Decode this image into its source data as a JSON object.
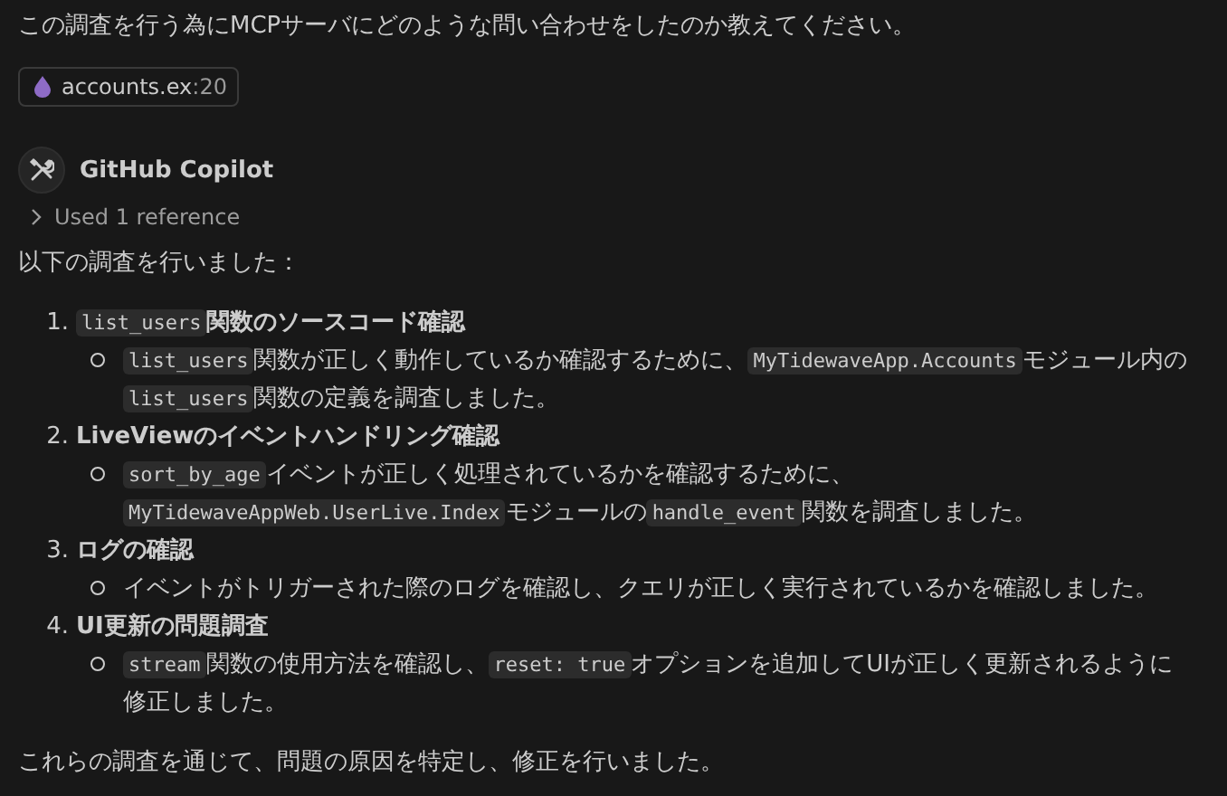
{
  "question": "この調査を行う為にMCPサーバにどのような問い合わせをしたのか教えてください。",
  "attachment": {
    "file": "accounts.ex",
    "line": ":20"
  },
  "assistant": {
    "name": "GitHub Copilot",
    "references": {
      "label": "Used 1 reference",
      "expanded": false
    }
  },
  "intro": "以下の調査を行いました：",
  "steps": [
    {
      "number": "1.",
      "heading": [
        {
          "kind": "code",
          "text": "list_users"
        },
        {
          "kind": "text",
          "text": "関数のソースコード確認"
        }
      ],
      "bullets": [
        [
          {
            "kind": "code",
            "text": "list_users"
          },
          {
            "kind": "text",
            "text": "関数が正しく動作しているか確認するために、"
          },
          {
            "kind": "code",
            "text": "MyTidewaveApp.Accounts"
          },
          {
            "kind": "text",
            "text": "モジュール内の"
          },
          {
            "kind": "code",
            "text": "list_users"
          },
          {
            "kind": "text",
            "text": "関数の定義を調査しました。"
          }
        ]
      ]
    },
    {
      "number": "2.",
      "heading": [
        {
          "kind": "text",
          "text": "LiveViewのイベントハンドリング確認"
        }
      ],
      "bullets": [
        [
          {
            "kind": "code",
            "text": "sort_by_age"
          },
          {
            "kind": "text",
            "text": "イベントが正しく処理されているかを確認するために、"
          },
          {
            "kind": "code",
            "text": "MyTidewaveAppWeb.UserLive.Index"
          },
          {
            "kind": "text",
            "text": "モジュールの"
          },
          {
            "kind": "code",
            "text": "handle_event"
          },
          {
            "kind": "text",
            "text": "関数を調査しました。"
          }
        ]
      ]
    },
    {
      "number": "3.",
      "heading": [
        {
          "kind": "text",
          "text": "ログの確認"
        }
      ],
      "bullets": [
        [
          {
            "kind": "text",
            "text": "イベントがトリガーされた際のログを確認し、クエリが正しく実行されているかを確認しました。"
          }
        ]
      ]
    },
    {
      "number": "4.",
      "heading": [
        {
          "kind": "text",
          "text": "UI更新の問題調査"
        }
      ],
      "bullets": [
        [
          {
            "kind": "code",
            "text": "stream"
          },
          {
            "kind": "text",
            "text": "関数の使用方法を確認し、"
          },
          {
            "kind": "code",
            "text": "reset: true"
          },
          {
            "kind": "text",
            "text": "オプションを追加してUIが正しく更新されるように修正しました。"
          }
        ]
      ]
    }
  ],
  "conclusion": "これらの調査を通じて、問題の原因を特定し、修正を行いました。"
}
